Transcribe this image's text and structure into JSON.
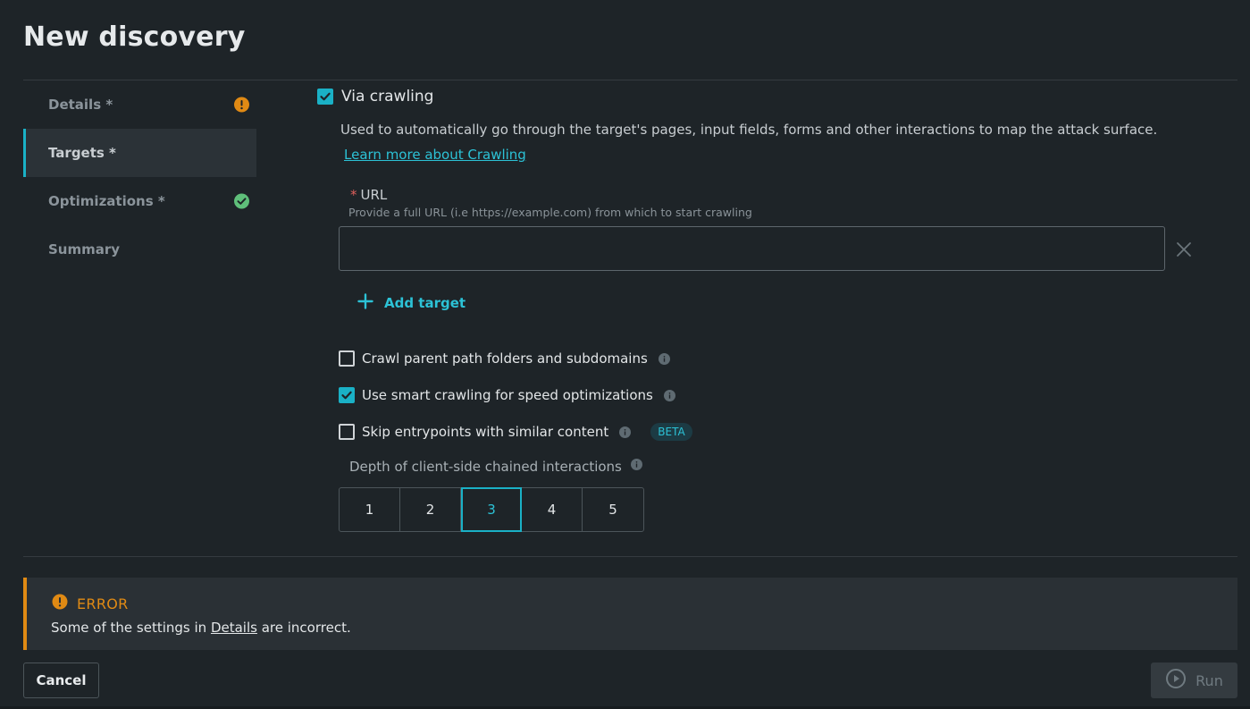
{
  "page": {
    "title": "New discovery"
  },
  "sidebar": {
    "items": [
      {
        "label": "Details *",
        "status": "warning"
      },
      {
        "label": "Targets *",
        "status": "active"
      },
      {
        "label": "Optimizations *",
        "status": "ok"
      },
      {
        "label": "Summary",
        "status": "none"
      }
    ]
  },
  "crawling": {
    "label": "Via crawling",
    "checked": true,
    "description": "Used to automatically go through the target's pages, input fields, forms and other interactions to map the attack surface.",
    "learn_more": "Learn more about Crawling"
  },
  "url": {
    "required_mark": "*",
    "label": "URL",
    "help": "Provide a full URL (i.e https://example.com) from which to start crawling",
    "value": "",
    "placeholder": ""
  },
  "add_target": {
    "label": "Add target"
  },
  "options": [
    {
      "label": "Crawl parent path folders and subdomains",
      "checked": false
    },
    {
      "label": "Use smart crawling for speed optimizations",
      "checked": true
    },
    {
      "label": "Skip entrypoints with similar content",
      "checked": false,
      "badge": "BETA"
    }
  ],
  "depth": {
    "label": "Depth of client-side chained interactions",
    "options": [
      "1",
      "2",
      "3",
      "4",
      "5"
    ],
    "selected": "3"
  },
  "error": {
    "title": "ERROR",
    "message_prefix": "Some of the settings in ",
    "message_link": "Details",
    "message_suffix": " are incorrect."
  },
  "footer": {
    "cancel_label": "Cancel",
    "run_label": "Run"
  },
  "colors": {
    "accent": "#1ab1c6",
    "warning": "#e08a14",
    "success": "#5fbf7a",
    "background": "#1e2428"
  }
}
